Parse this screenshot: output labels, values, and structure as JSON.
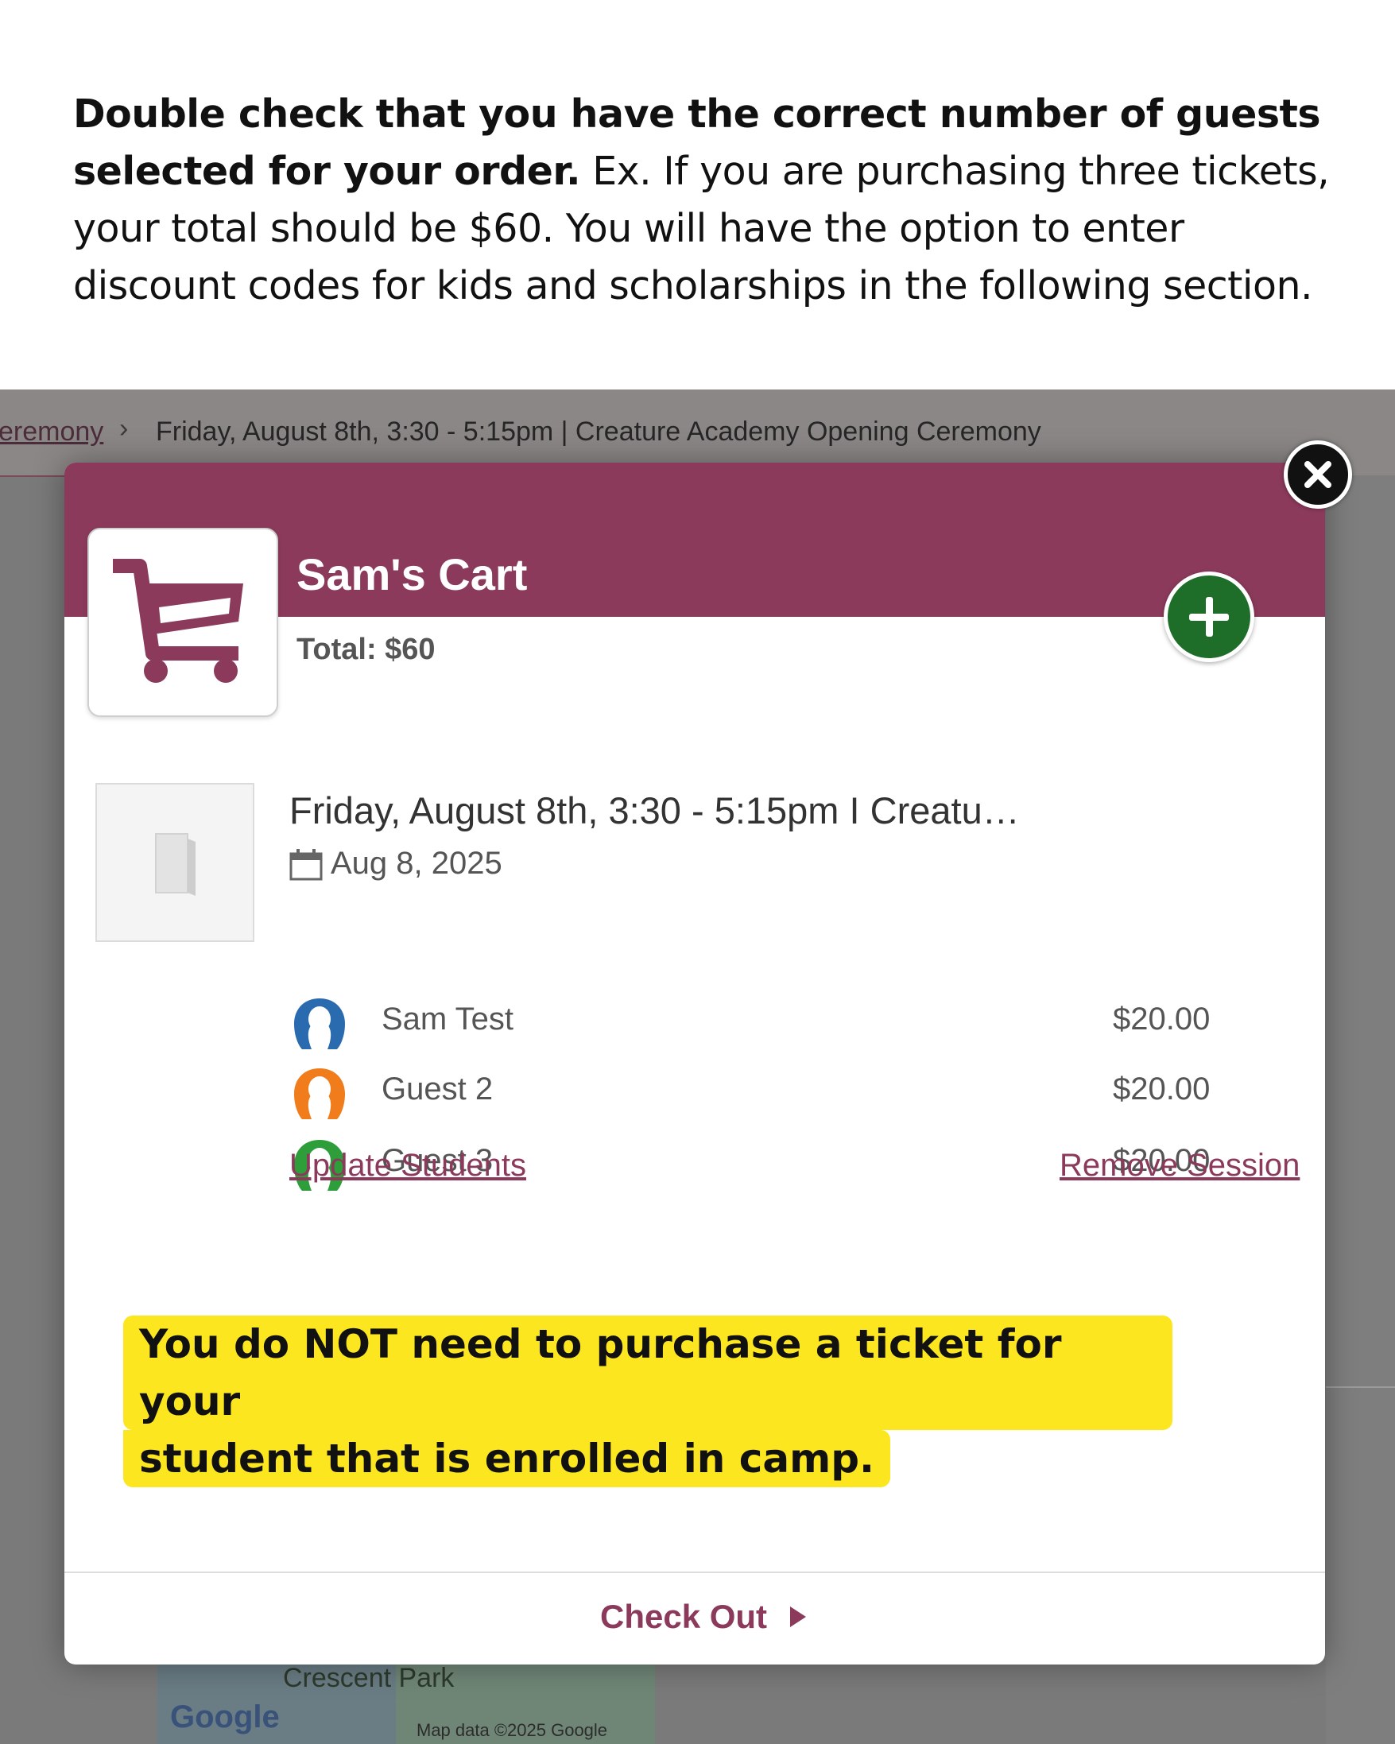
{
  "instructions": {
    "bold": "Double check that you have the correct number of guests selected for your order.",
    "rest": " Ex. If you are purchasing three tickets, your total should be $60. You will have the option to enter discount codes for kids and scholarships in the following section."
  },
  "breadcrumb": {
    "prev_link": "eremony",
    "separator": "›",
    "current": "Friday, August 8th, 3:30 - 5:15pm | Creature Academy Opening Ceremony"
  },
  "map": {
    "park_label": "Crescent Park",
    "logo": "Google",
    "credit": "Map data ©2025 Google"
  },
  "cart": {
    "title": "Sam's Cart",
    "total": "Total: $60",
    "icon": "shopping-cart-icon",
    "add_icon": "plus-icon"
  },
  "session": {
    "title": "Friday, August 8th, 3:30 - 5:15pm I Creatu…",
    "date": "Aug 8, 2025",
    "guests": [
      {
        "name": "Sam Test",
        "price": "$20.00",
        "color": "#2a6bb0"
      },
      {
        "name": "Guest 2",
        "price": "$20.00",
        "color": "#f07c1b"
      },
      {
        "name": "Guest 3",
        "price": "$20.00",
        "color": "#2e9e3a"
      }
    ],
    "update_link": "Update Students",
    "remove_link": "Remove Session"
  },
  "note": {
    "line1": "You do NOT need to purchase a ticket for your",
    "line2": "student that is enrolled in camp."
  },
  "footer": {
    "checkout": "Check Out"
  },
  "colors": {
    "brand": "#8b3a5b",
    "add_button": "#1e6e2a",
    "highlight": "#fbe61f"
  }
}
